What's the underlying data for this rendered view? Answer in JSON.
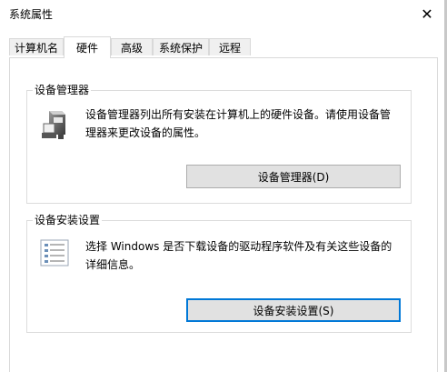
{
  "window": {
    "title": "系统属性",
    "close_glyph": "✕"
  },
  "tabs": [
    {
      "label": "计算机名",
      "active": false
    },
    {
      "label": "硬件",
      "active": true
    },
    {
      "label": "高级",
      "active": false
    },
    {
      "label": "系统保护",
      "active": false
    },
    {
      "label": "远程",
      "active": false
    }
  ],
  "device_manager": {
    "group_title": "设备管理器",
    "desc_line1": "设备管理器列出所有安装在计算机上的硬件设备。请使用设备管",
    "desc_line2": "理器来更改设备的属性。",
    "button_label": "设备管理器(D)",
    "icon": "device-manager-icon"
  },
  "device_install": {
    "group_title": "设备安装设置",
    "desc_line1": "选择 Windows 是否下载设备的驱动程序软件及有关这些设备的",
    "desc_line2": "详细信息。",
    "button_label": "设备安装设置(S)",
    "icon": "checklist-icon"
  }
}
